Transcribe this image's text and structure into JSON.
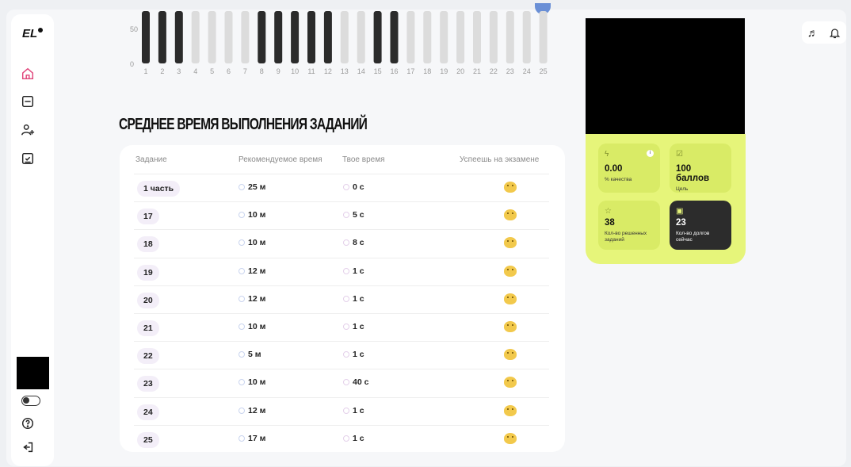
{
  "brand": {
    "logo": "EL"
  },
  "chart_data": {
    "type": "bar",
    "categories": [
      "1",
      "2",
      "3",
      "4",
      "5",
      "6",
      "7",
      "8",
      "9",
      "10",
      "11",
      "12",
      "13",
      "14",
      "15",
      "16",
      "17",
      "18",
      "19",
      "20",
      "21",
      "22",
      "23",
      "24",
      "25"
    ],
    "values": [
      100,
      100,
      100,
      0,
      0,
      0,
      0,
      100,
      100,
      100,
      100,
      100,
      0,
      0,
      100,
      100,
      0,
      0,
      0,
      0,
      0,
      0,
      0,
      0,
      0
    ],
    "y_ticks": [
      "0",
      "50"
    ],
    "ylim": [
      0,
      100
    ]
  },
  "section_title": "СРЕДНЕЕ ВРЕМЯ ВЫПОЛНЕНИЯ ЗАДАНИЙ",
  "table": {
    "headers": [
      "Задание",
      "Рекомендуемое время",
      "Твое время",
      "Успеешь на экзамене"
    ],
    "rows": [
      {
        "task": "1 часть",
        "rec": "25 м",
        "your": "0 с"
      },
      {
        "task": "17",
        "rec": "10 м",
        "your": "5 с"
      },
      {
        "task": "18",
        "rec": "10 м",
        "your": "8 с"
      },
      {
        "task": "19",
        "rec": "12 м",
        "your": "1 с"
      },
      {
        "task": "20",
        "rec": "12 м",
        "your": "1 с"
      },
      {
        "task": "21",
        "rec": "10 м",
        "your": "1 с"
      },
      {
        "task": "22",
        "rec": "5 м",
        "your": "1 с"
      },
      {
        "task": "23",
        "rec": "10 м",
        "your": "40 с"
      },
      {
        "task": "24",
        "rec": "12 м",
        "your": "1 с"
      },
      {
        "task": "25",
        "rec": "17 м",
        "your": "1 с"
      }
    ]
  },
  "stats": {
    "quality": {
      "value": "0.00",
      "label": "% качества",
      "info": "i"
    },
    "goal": {
      "value": "100 баллов",
      "label": "Цель"
    },
    "solved": {
      "value": "38",
      "label": "Кол-во решенных заданий"
    },
    "debts": {
      "value": "23",
      "label": "Кол-во долгов сейчас"
    }
  },
  "colors": {
    "accent_yellow": "#e6f57a",
    "bar_active": "#2b2b2b",
    "bar_inactive": "#dcdcdc"
  }
}
